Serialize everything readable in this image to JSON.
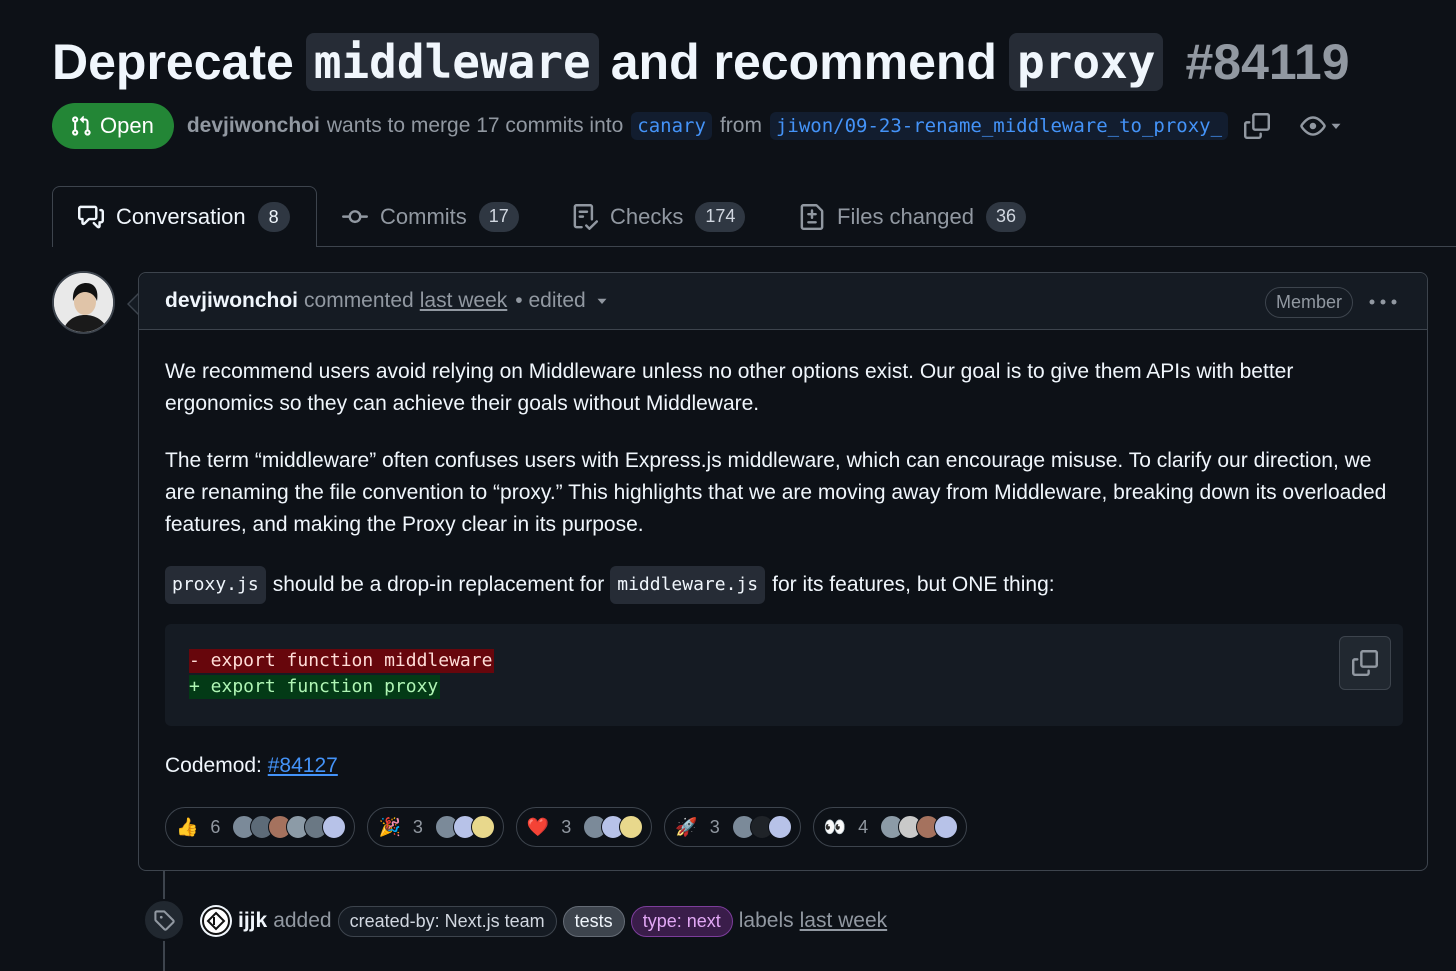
{
  "title": {
    "part1": "Deprecate",
    "code1": "middleware",
    "part2": "and recommend",
    "code2": "proxy",
    "number": "#84119"
  },
  "meta": {
    "state": "Open",
    "author": "devjiwonchoi",
    "text_merge": "wants to merge 17 commits into",
    "base_branch": "canary",
    "text_from": "from",
    "head_branch": "jiwon/09-23-rename_middleware_to_proxy_"
  },
  "tabs": [
    {
      "label": "Conversation",
      "count": "8"
    },
    {
      "label": "Commits",
      "count": "17"
    },
    {
      "label": "Checks",
      "count": "174"
    },
    {
      "label": "Files changed",
      "count": "36"
    }
  ],
  "comment": {
    "author": "devjiwonchoi",
    "action": "commented",
    "when": "last week",
    "edited": "• edited",
    "role_badge": "Member",
    "paragraph1": "We recommend users avoid relying on Middleware unless no other options exist. Our goal is to give them APIs with better ergonomics so they can achieve their goals without Middleware.",
    "paragraph2": "The term “middleware” often confuses users with Express.js middleware, which can encourage misuse. To clarify our direction, we are renaming the file convention to “proxy.” This highlights that we are moving away from Middleware, breaking down its overloaded features, and making the Proxy clear in its purpose.",
    "p3_code1": "proxy.js",
    "p3_text1": "should be a drop-in replacement for",
    "p3_code2": "middleware.js",
    "p3_text2": "for its features, but ONE thing:",
    "code_removed": "- export function middleware",
    "code_added": "+ export function proxy",
    "codemod_label": "Codemod:",
    "codemod_link": "#84127"
  },
  "reactions": [
    {
      "emoji": "👍",
      "count": "6",
      "faces": [
        "#7b8a99",
        "#5d6b78",
        "#a5725e",
        "#8c9ba7",
        "#6a7884",
        "#b7c2e8"
      ]
    },
    {
      "emoji": "🎉",
      "count": "3",
      "faces": [
        "#7b8a99",
        "#b7c2e8",
        "#e8d88c"
      ]
    },
    {
      "emoji": "❤️",
      "count": "3",
      "faces": [
        "#7b8a99",
        "#b7c2e8",
        "#e8d88c"
      ]
    },
    {
      "emoji": "🚀",
      "count": "3",
      "faces": [
        "#7b8a99",
        "#1f2328",
        "#b7c2e8"
      ]
    },
    {
      "emoji": "👀",
      "count": "4",
      "faces": [
        "#8c9ba7",
        "#c9c9c9",
        "#a5725e",
        "#b7c2e8"
      ]
    }
  ],
  "timeline": {
    "actor": "ijjk",
    "action": "added",
    "labels": [
      "created-by: Next.js team",
      "tests",
      "type: next"
    ],
    "suffix": "labels",
    "when": "last week"
  },
  "colors": {
    "background": "#0d1117",
    "open_green": "#238636",
    "link_blue": "#4493f8",
    "diff_removed": "#67060c",
    "diff_added": "#033a16"
  }
}
